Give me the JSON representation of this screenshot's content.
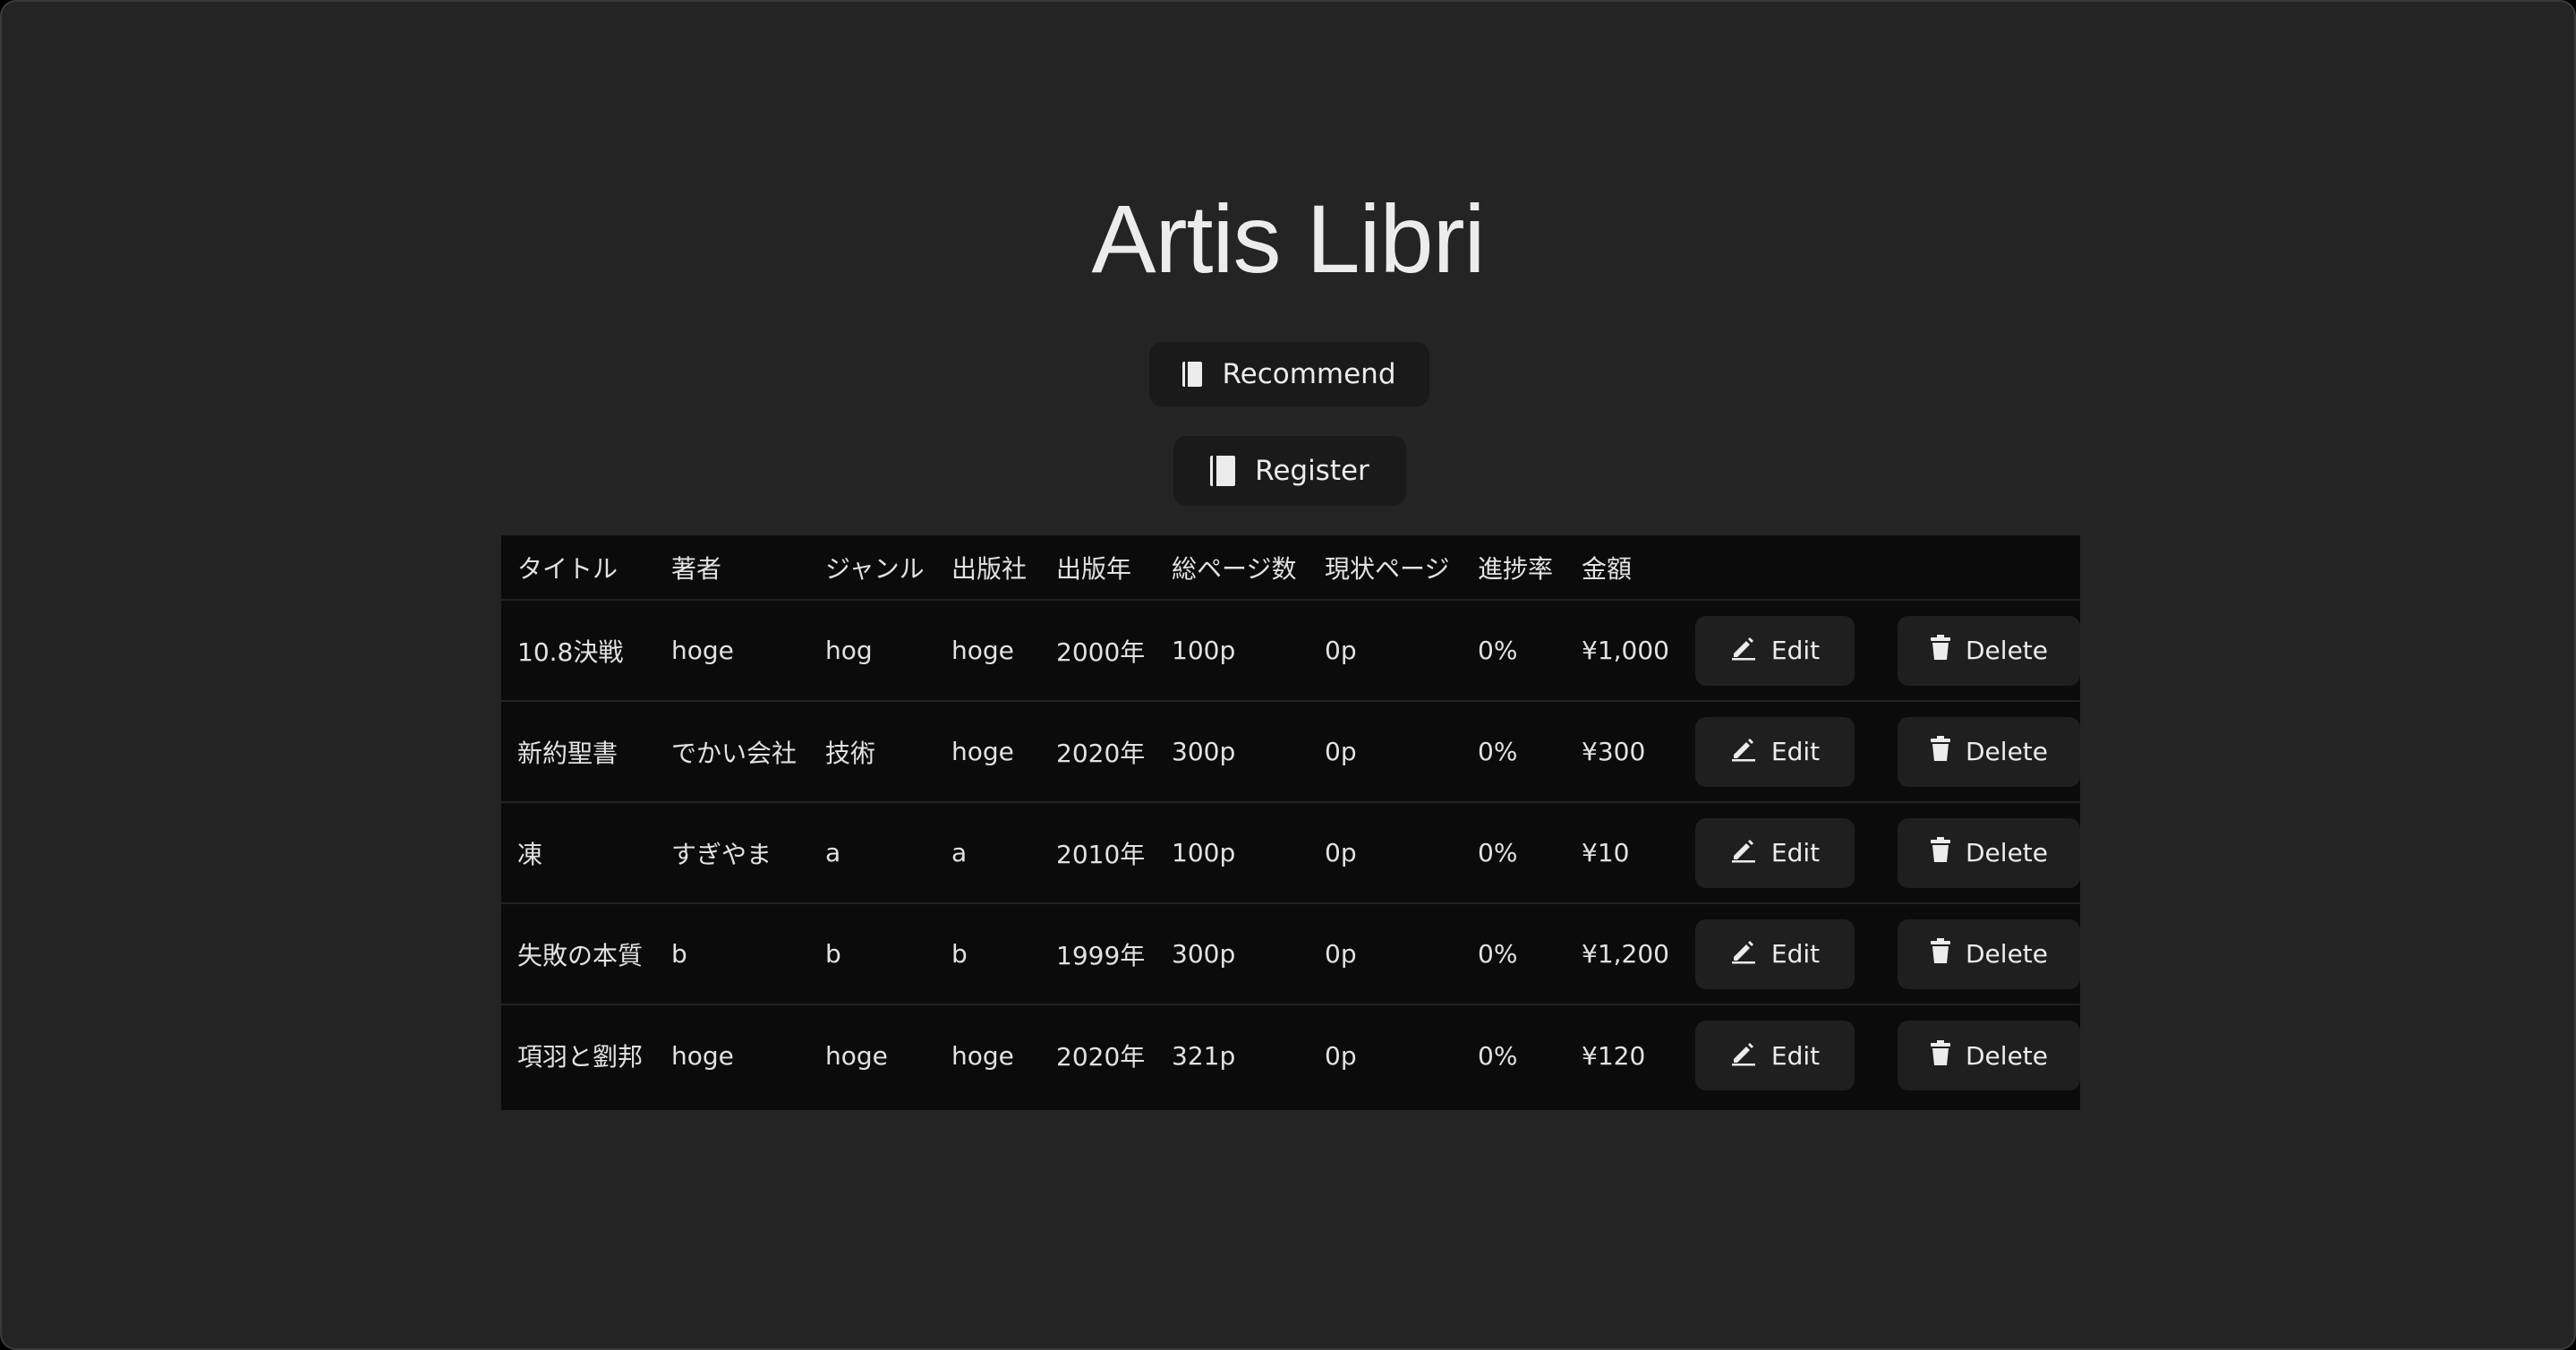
{
  "app": {
    "title": "Artis Libri"
  },
  "actions": {
    "recommend_label": "Recommend",
    "register_label": "Register",
    "edit_label": "Edit",
    "delete_label": "Delete"
  },
  "table": {
    "headers": [
      "タイトル",
      "著者",
      "ジャンル",
      "出版社",
      "出版年",
      "総ページ数",
      "現状ページ",
      "進捗率",
      "金額"
    ],
    "rows": [
      [
        "10.8決戦",
        "hoge",
        "hog",
        "hoge",
        "2000年",
        "100p",
        "0p",
        "0%",
        "¥1,000"
      ],
      [
        "新約聖書",
        "でかい会社",
        "技術",
        "hoge",
        "2020年",
        "300p",
        "0p",
        "0%",
        "¥300"
      ],
      [
        "凍",
        "すぎやま",
        "a",
        "a",
        "2010年",
        "100p",
        "0p",
        "0%",
        "¥10"
      ],
      [
        "失敗の本質",
        "b",
        "b",
        "b",
        "1999年",
        "300p",
        "0p",
        "0%",
        "¥1,200"
      ],
      [
        "項羽と劉邦",
        "hoge",
        "hoge",
        "hoge",
        "2020年",
        "321p",
        "0p",
        "0%",
        "¥120"
      ]
    ]
  },
  "icons": {
    "recommend": "book-icon",
    "register": "book-icon",
    "edit": "pencil-icon",
    "delete": "trash-icon"
  },
  "colors": {
    "window_bg": "#242424",
    "table_bg": "#0b0b0c",
    "button_bg": "#1f1f1f",
    "text": "#e6e6e6"
  }
}
